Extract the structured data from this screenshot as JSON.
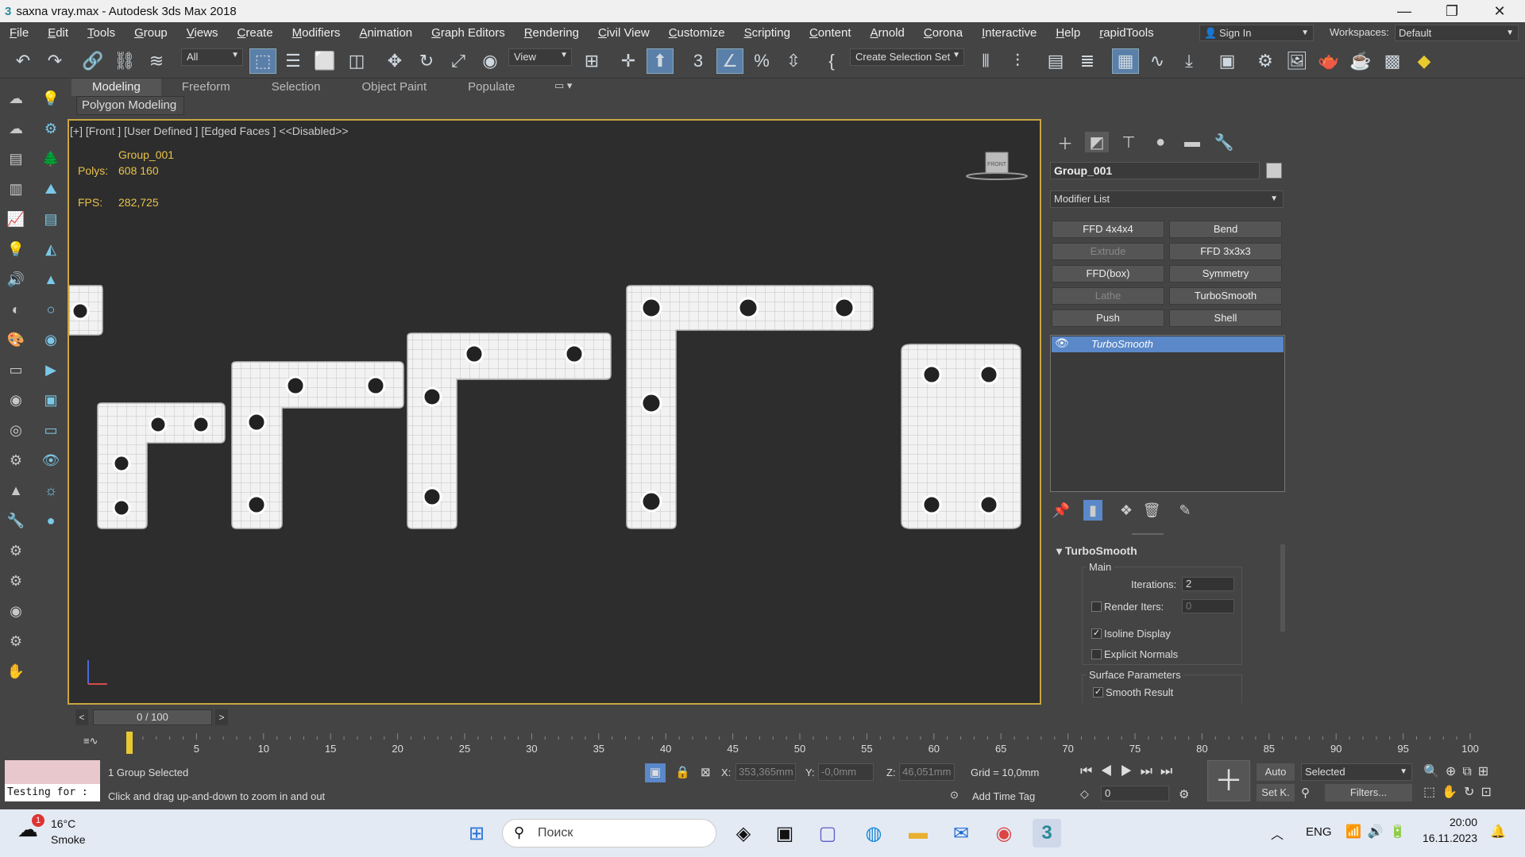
{
  "window": {
    "title": "saxna vray.max - Autodesk 3ds Max 2018",
    "app_icon": "3ds-max-icon"
  },
  "menu": [
    "File",
    "Edit",
    "Tools",
    "Group",
    "Views",
    "Create",
    "Modifiers",
    "Animation",
    "Graph Editors",
    "Rendering",
    "Civil View",
    "Customize",
    "Scripting",
    "Content",
    "Arnold",
    "Corona",
    "Interactive",
    "Help",
    "rapidTools"
  ],
  "account": {
    "sign_in": "Sign In",
    "workspaces_label": "Workspaces:",
    "workspace": "Default"
  },
  "toolbar": {
    "filter": "All",
    "ref_coord": "View",
    "selection_set": "Create Selection Set"
  },
  "ribbon": {
    "tabs": [
      "Modeling",
      "Freeform",
      "Selection",
      "Object Paint",
      "Populate"
    ],
    "active": "Modeling",
    "panel": "Polygon Modeling"
  },
  "viewport": {
    "label": "[+] [Front ] [User Defined ] [Edged Faces ]  <<Disabled>>",
    "object_name": "Group_001",
    "polys_label": "Polys:",
    "polys_value": "608 160",
    "fps_label": "FPS:",
    "fps_value": "282,725",
    "viewcube_label": "FRONT"
  },
  "command_panel": {
    "object_name": "Group_001",
    "modifier_list": "Modifier List",
    "buttons": [
      {
        "label": "FFD 4x4x4",
        "enabled": true
      },
      {
        "label": "Bend",
        "enabled": true
      },
      {
        "label": "Extrude",
        "enabled": false
      },
      {
        "label": "FFD 3x3x3",
        "enabled": true
      },
      {
        "label": "FFD(box)",
        "enabled": true
      },
      {
        "label": "Symmetry",
        "enabled": true
      },
      {
        "label": "Lathe",
        "enabled": false
      },
      {
        "label": "TurboSmooth",
        "enabled": true
      },
      {
        "label": "Push",
        "enabled": true
      },
      {
        "label": "Shell",
        "enabled": true
      }
    ],
    "stack": [
      "TurboSmooth"
    ]
  },
  "turbosmooth": {
    "title": "TurboSmooth",
    "main_label": "Main",
    "iterations_label": "Iterations:",
    "iterations": "2",
    "render_iters_label": "Render Iters:",
    "render_iters": "0",
    "isoline_label": "Isoline Display",
    "isoline": true,
    "explicit_normals_label": "Explicit Normals",
    "explicit_normals": false,
    "surface_label": "Surface Parameters",
    "smooth_result_label": "Smooth Result",
    "smooth_result": true
  },
  "timeline": {
    "frame": "0 / 100",
    "ticks": [
      "0",
      "5",
      "10",
      "15",
      "20",
      "25",
      "30",
      "35",
      "40",
      "45",
      "50",
      "55",
      "60",
      "65",
      "70",
      "75",
      "80",
      "85",
      "90",
      "95",
      "100"
    ]
  },
  "status": {
    "maxscript_text": "Testing for :",
    "selection": "1 Group Selected",
    "prompt": "Click and drag up-and-down to zoom in and out",
    "x_label": "X:",
    "x": "353,365mm",
    "y_label": "Y:",
    "y": "-0,0mm",
    "z_label": "Z:",
    "z": "46,051mm",
    "grid": "Grid = 10,0mm",
    "add_time_tag": "Add Time Tag",
    "auto": "Auto",
    "setk": "Set K.",
    "selected": "Selected",
    "filters": "Filters...",
    "frame_field": "0"
  },
  "taskbar": {
    "weather_temp": "16°C",
    "weather_desc": "Smoke",
    "weather_badge": "1",
    "search": "Поиск",
    "lang": "ENG",
    "time": "20:00",
    "date": "16.11.2023"
  }
}
